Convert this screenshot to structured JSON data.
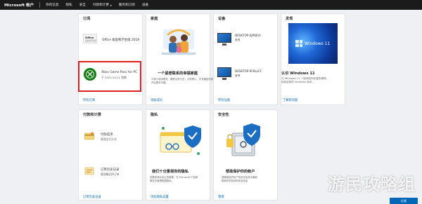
{
  "topbar": {
    "brand": "Microsoft 帐户",
    "nav": [
      "你的信息",
      "隐私",
      "安全",
      "付款和计费",
      "服务和订阅",
      "设备"
    ],
    "nav_dropdown_index": 3
  },
  "subscriptions": {
    "title": "订阅",
    "office": {
      "thumb_title": "Office",
      "thumb_sub": "家庭和学生版",
      "name": "Office 家庭和学生版 2019"
    },
    "xbox": {
      "name": "Xbox Game Pass for PC",
      "status": "于 2021/11/11 到期"
    },
    "link": "所有订阅"
  },
  "family": {
    "title": "家庭",
    "heading": "一个紧密联系的幸福家庭",
    "desc1": "与家人保持联系，跟踪共享日历，共享照片，共享播放列表，并",
    "desc2": "开启更多乐趣。",
    "link": "添加成员"
  },
  "devices": {
    "title": "设备",
    "items": [
      {
        "name": "DESKTOP-SJP8EVI",
        "sub": "管理"
      },
      {
        "name": "DESKTOP-9F8LLFC",
        "sub": "管理"
      }
    ],
    "link": "所有设备"
  },
  "discover": {
    "title": "发现",
    "banner_text": "Windows 11",
    "heading": "认识 Windows 11",
    "desc1": "与 Windows 11 一起体验你热爱的事物。",
    "desc2": "体验全新的 Windows 版本。",
    "link": "了解新功能"
  },
  "payments": {
    "title": "付款和计费",
    "item1": {
      "title": "付款选项",
      "sub": "管理支付方式"
    },
    "item2": {
      "title": "订单历史记录",
      "sub": "管理最近的订单"
    },
    "link": "订单历史记录"
  },
  "privacy": {
    "title": "隐私",
    "heading": "我们十分重视你的隐私",
    "desc1": "查看你保存到云的数据，在 Microsoft 产品和",
    "desc2": "服务中管理数据隐私。",
    "link": "浏览隐私设置"
  },
  "security": {
    "title": "安全性",
    "heading": "帮助保护你的帐户",
    "desc1": "请确保保护帐户的安全信息为最新",
    "desc2": "更新你的密码和安全信息",
    "link": "管理"
  },
  "feedback": {
    "label": "反馈"
  },
  "watermark": "游民攻略组",
  "colors": {
    "accent": "#0067b8",
    "xbox_green": "#107c10",
    "highlight": "#e02020"
  }
}
